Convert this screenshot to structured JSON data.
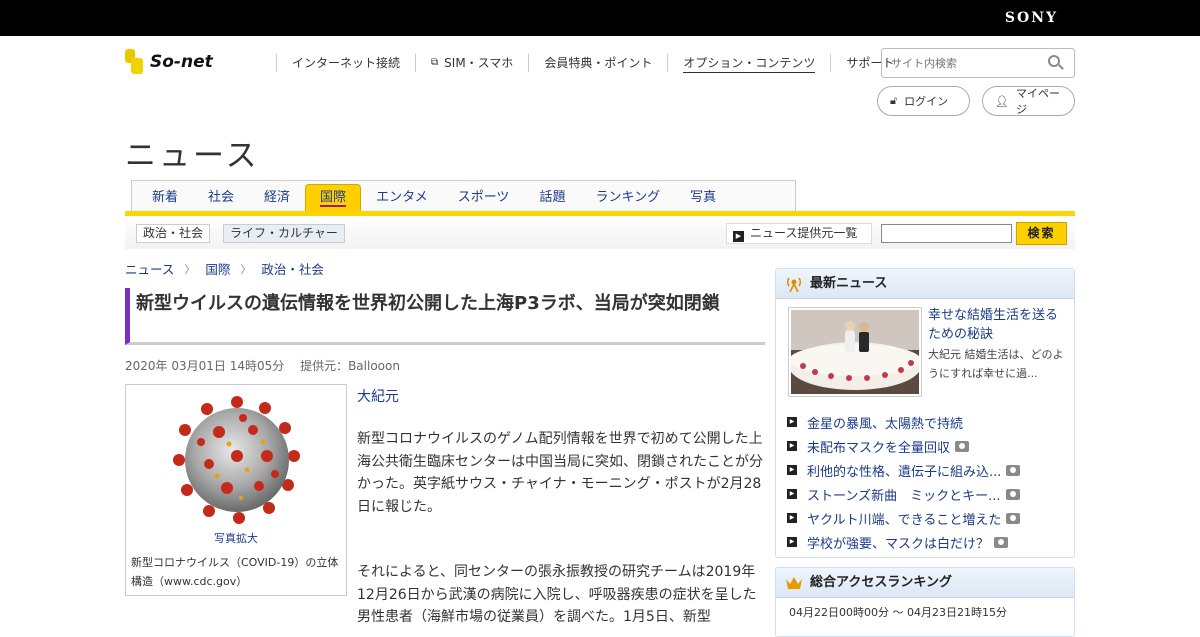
{
  "topbar": {
    "brand": "SONY"
  },
  "header": {
    "logo_text": "So-net",
    "nav": [
      {
        "label": "インターネット接続"
      },
      {
        "label": "SIM・スマホ"
      },
      {
        "label": "会員特典・ポイント"
      },
      {
        "label": "オプション・コンテンツ"
      },
      {
        "label": "サポート"
      }
    ],
    "search_placeholder": "サイト内検索",
    "login_label": "ログイン",
    "mypage_label": "マイページ"
  },
  "section_title": "ニュース",
  "tabs": [
    "新着",
    "社会",
    "経済",
    "国際",
    "エンタメ",
    "スポーツ",
    "話題",
    "ランキング",
    "写真"
  ],
  "subbar": {
    "cat1": "政治・社会",
    "cat2": "ライフ・カルチャー",
    "provider_link": "ニュース提供元一覧",
    "search_button": "検索"
  },
  "breadcrumb": [
    "ニュース",
    "国際",
    "政治・社会"
  ],
  "article": {
    "title": "新型ウイルスの遺伝情報を世界初公開した上海P3ラボ、当局が突如閉鎖",
    "date": "2020年 03月01日 14時05分",
    "provider": "提供元：Ballooon",
    "photo_link": "写真拡大",
    "photo_caption": "新型コロナウイルス（COVID-19）の立体構造（www.cdc.gov）",
    "author": "大紀元",
    "p1": "新型コロナウイルスのゲノム配列情報を世界で初めて公開した上海公共衛生臨床センターは中国当局に突如、閉鎖されたことが分かった。英字紙サウス・チャイナ・モーニング・ポストが2月28日に報じた。",
    "p2": "それによると、同センターの張永振教授の研究チームは2019年12月26日から武漢の病院に入院し、呼吸器疾患の症状を呈した男性患者（海鮮市場の従業員）を調べた。1月5日、新型"
  },
  "latest": {
    "heading": "最新ニュース",
    "feature_title": "幸せな結婚生活を送るための秘訣",
    "feature_desc": "大紀元 結婚生活は、どのようにすれば幸せに過...",
    "items": [
      {
        "label": "金星の暴風、太陽熱で持続"
      },
      {
        "label": "未配布マスクを全量回収"
      },
      {
        "label": "利他的な性格、遺伝子に組み込..."
      },
      {
        "label": "ストーンズ新曲　ミックとキー..."
      },
      {
        "label": "ヤクルト川端、できること増えた"
      },
      {
        "label": "学校が強要、マスクは白だけ？"
      }
    ]
  },
  "ranking": {
    "heading": "総合アクセスランキング",
    "period": "04月22日00時00分 ～ 04月23日21時15分"
  }
}
